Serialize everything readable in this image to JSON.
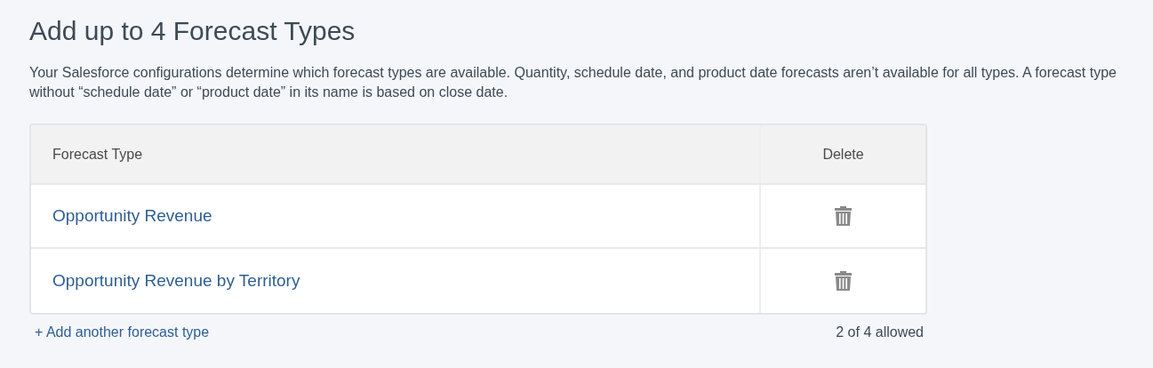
{
  "title": "Add up to 4 Forecast Types",
  "description": "Your Salesforce configurations determine which forecast types are available. Quantity, schedule date, and product date forecasts aren’t available for all types. A forecast type without “schedule date” or “product date” in its name is based on close date.",
  "table": {
    "columns": [
      "Forecast Type",
      "Delete"
    ],
    "rows": [
      {
        "name": "Opportunity Revenue"
      },
      {
        "name": "Opportunity Revenue by Territory"
      }
    ]
  },
  "add_link": "+ Add another forecast type",
  "count": "2 of 4 allowed"
}
